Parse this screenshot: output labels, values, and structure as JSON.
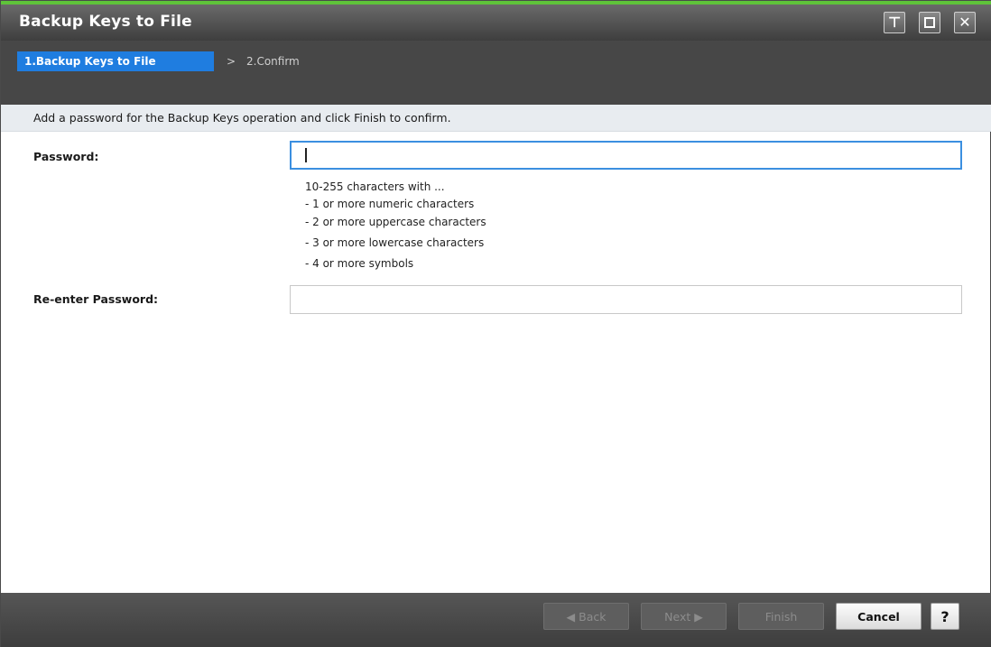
{
  "window": {
    "title": "Backup Keys to File",
    "controls": {
      "pin_icon": "pin-icon",
      "maximize_icon": "maximize-icon",
      "close_icon": "close-icon"
    }
  },
  "steps": {
    "active_label": "1.Backup Keys to File",
    "separator": ">",
    "next_label": "2.Confirm"
  },
  "instruction": "Add a password for the Backup Keys operation and click Finish to confirm.",
  "form": {
    "password_label": "Password:",
    "password_value": "",
    "hint_lines": [
      "10-255 characters with ...",
      "- 1 or more numeric characters",
      "- 2 or more uppercase characters",
      "- 3 or more lowercase characters",
      "- 4 or more symbols"
    ],
    "reenter_label": "Re-enter Password:",
    "reenter_value": ""
  },
  "footer": {
    "back_label": "◀ Back",
    "next_label": "Next ▶",
    "finish_label": "Finish",
    "cancel_label": "Cancel",
    "help_label": "?"
  },
  "colors": {
    "accent": "#5fc33a",
    "step_active": "#1f7de0",
    "focus_border": "#3b8fe0"
  }
}
